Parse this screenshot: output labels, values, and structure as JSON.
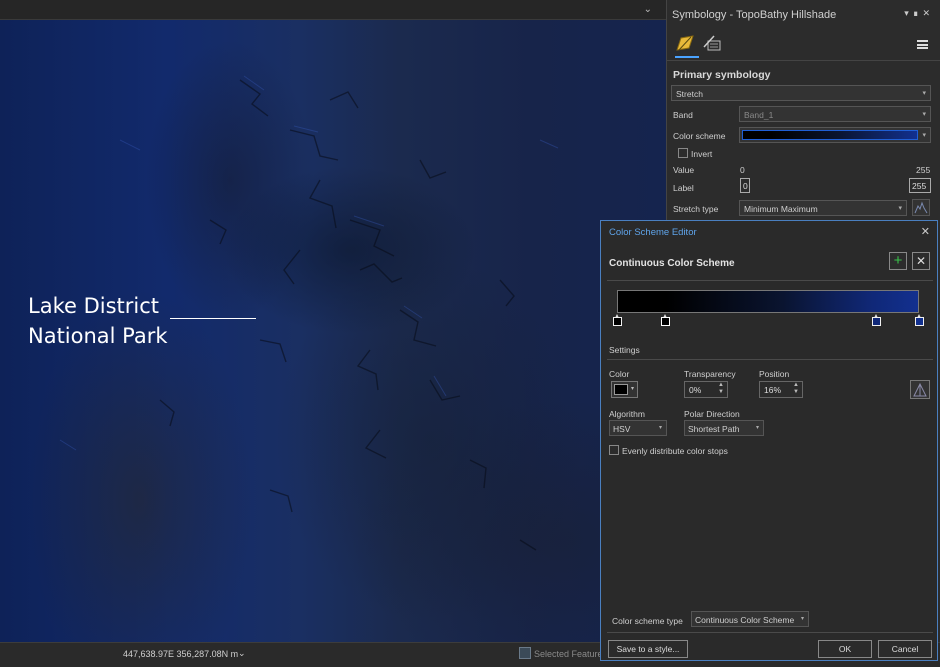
{
  "map": {
    "label_line1": "Lake District",
    "label_line2": "National Park"
  },
  "status": {
    "coordinates": "447,638.97E 356,287.08N m",
    "selected_features": "Selected Feature"
  },
  "symbology": {
    "title": "Symbology - TopoBathy Hillshade",
    "primary_heading": "Primary symbology",
    "renderer": "Stretch",
    "band_label": "Band",
    "band_value": "Band_1",
    "color_scheme_label": "Color scheme",
    "invert_label": "Invert",
    "value_label": "Value",
    "value_min": "0",
    "value_max": "255",
    "label_label": "Label",
    "label_min": "0",
    "label_max": "255",
    "stretch_type_label": "Stretch type",
    "stretch_type_value": "Minimum Maximum"
  },
  "editor": {
    "title": "Color Scheme Editor",
    "heading": "Continuous Color Scheme",
    "settings_label": "Settings",
    "color_label": "Color",
    "transparency_label": "Transparency",
    "transparency_value": "0%",
    "position_label": "Position",
    "position_value": "16%",
    "algorithm_label": "Algorithm",
    "algorithm_value": "HSV",
    "polar_label": "Polar Direction",
    "polar_value": "Shortest Path",
    "evenly_label": "Evenly distribute color stops",
    "scheme_type_label": "Color scheme type",
    "scheme_type_value": "Continuous Color Scheme",
    "save_button": "Save to a style...",
    "ok_button": "OK",
    "cancel_button": "Cancel",
    "stop_positions_percent": [
      0,
      16,
      86,
      100
    ],
    "selected_stop": 1
  },
  "colors": {
    "accent": "#4aa3ff",
    "ramp_start": "#000000",
    "ramp_end": "#12308f",
    "add_green": "#39c24a"
  }
}
